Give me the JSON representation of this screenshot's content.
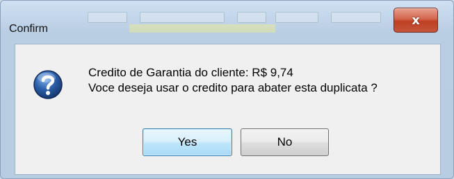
{
  "window": {
    "title": "Confirm",
    "close_glyph": "x"
  },
  "message": {
    "line1": "Credito de Garantia do cliente: R$ 9,74",
    "line2": "Voce deseja usar o credito para abater esta duplicata ?"
  },
  "icon": {
    "name": "question-icon",
    "color": "#2a5ea8"
  },
  "buttons": {
    "yes_label": "Yes",
    "no_label": "No"
  },
  "colors": {
    "close_button": "#c94a2f",
    "default_button_border": "#3c7fb1",
    "dialog_body": "#f0f0f0"
  }
}
